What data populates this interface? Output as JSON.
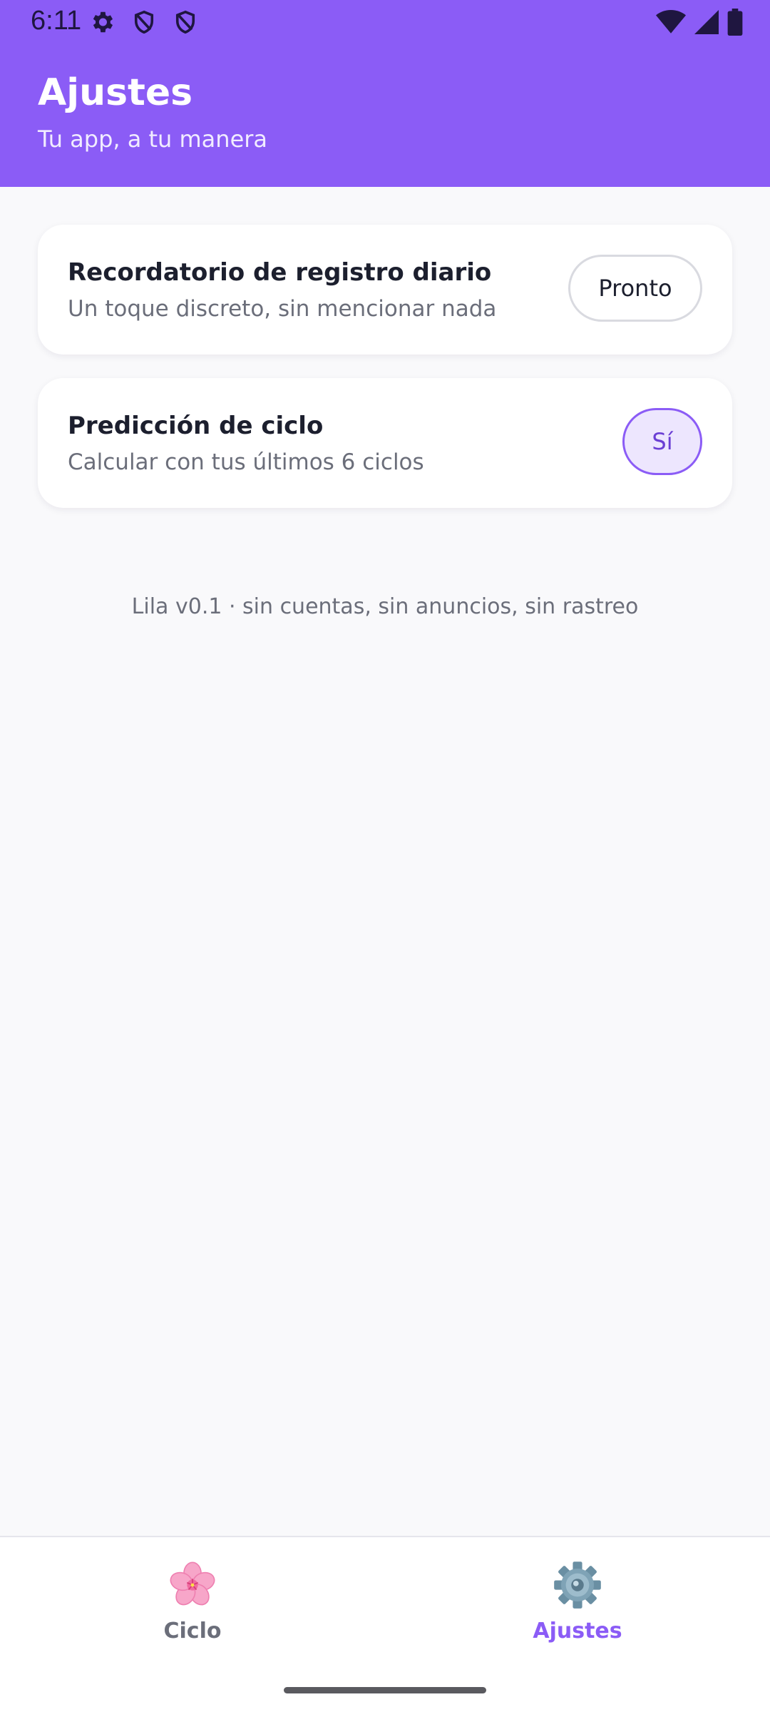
{
  "status_bar": {
    "time": "6:11",
    "left_icons": [
      "gear-icon",
      "shield-icon",
      "shield-icon"
    ],
    "right_icons": [
      "wifi-icon",
      "signal-icon",
      "battery-icon"
    ]
  },
  "header": {
    "title": "Ajustes",
    "subtitle": "Tu app, a tu manera",
    "background_color": "#8b5cf6"
  },
  "settings": [
    {
      "title": "Recordatorio de registro diario",
      "description": "Un toque discreto, sin mencionar nada",
      "button_label": "Pronto"
    },
    {
      "title": "Predicción de ciclo",
      "description": "Calcular con tus últimos 6 ciclos",
      "button_label": "Sí"
    }
  ],
  "footer_note": "Lila v0.1 · sin cuentas, sin anuncios, sin rastreo",
  "bottom_nav": {
    "items": [
      {
        "label": "Ciclo",
        "icon": "cherry-blossom-icon",
        "active": false
      },
      {
        "label": "Ajustes",
        "icon": "gear-icon",
        "active": true
      }
    ],
    "active_color": "#8b5cf6"
  }
}
